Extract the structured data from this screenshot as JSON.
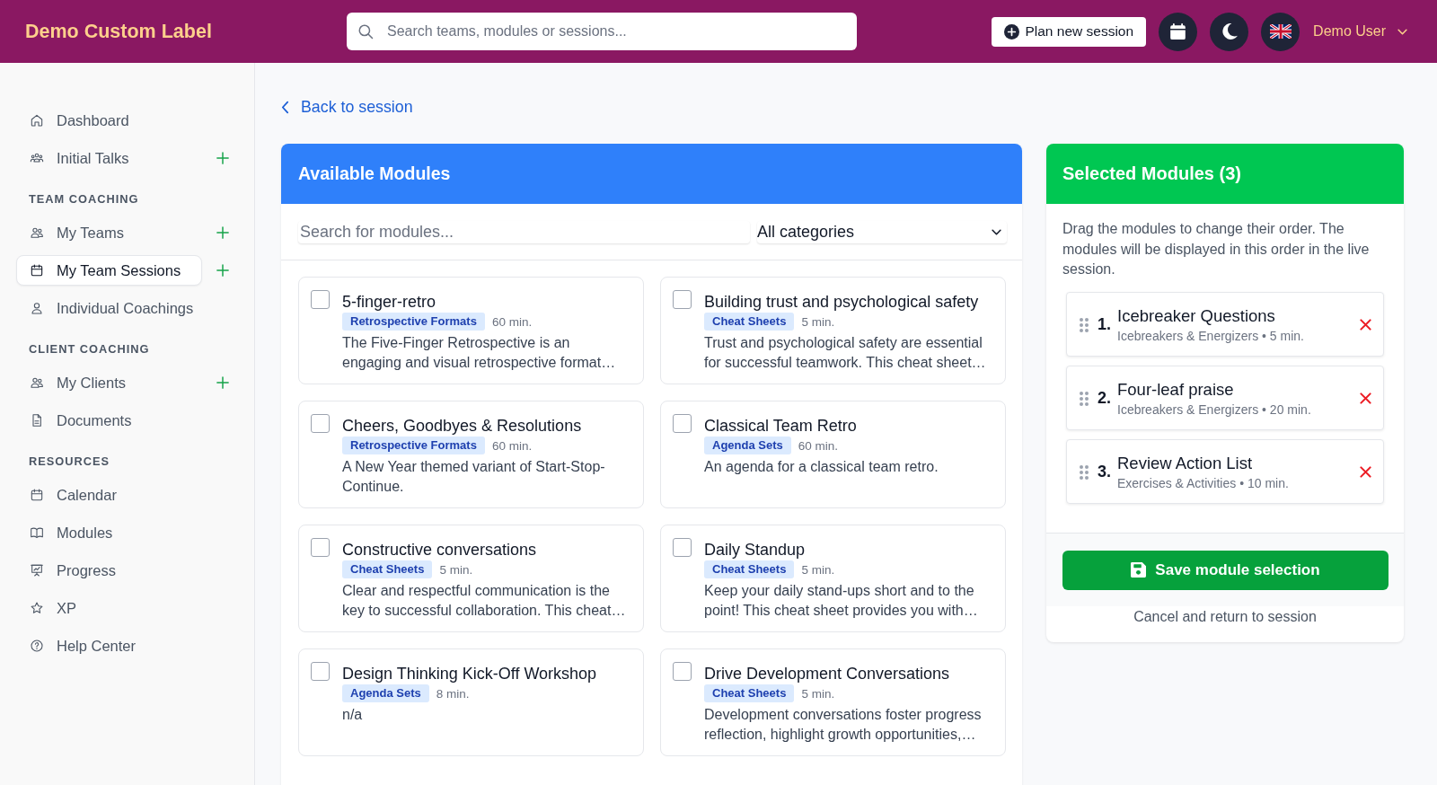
{
  "header": {
    "logo": "Demo Custom Label",
    "search": {
      "placeholder": "Search teams, modules or sessions..."
    },
    "plan_button": "Plan new session",
    "user_menu": "Demo User"
  },
  "sidebar": {
    "groups": [
      {
        "items": [
          {
            "label": "Dashboard",
            "selected": false,
            "add_button": false
          },
          {
            "label": "Initial Talks",
            "selected": false,
            "add_button": true
          }
        ]
      },
      {
        "heading": "TEAM COACHING",
        "items": [
          {
            "label": "My Teams",
            "selected": false,
            "add_button": true
          },
          {
            "label": "My Team Sessions",
            "selected": true,
            "add_button": true
          },
          {
            "label": "Individual Coachings",
            "selected": false,
            "add_button": false
          }
        ]
      },
      {
        "heading": "CLIENT COACHING",
        "items": [
          {
            "label": "My Clients",
            "selected": false,
            "add_button": true
          },
          {
            "label": "Documents",
            "selected": false,
            "add_button": false
          }
        ]
      },
      {
        "heading": "RESOURCES",
        "items": [
          {
            "label": "Calendar",
            "selected": false,
            "add_button": false
          },
          {
            "label": "Modules",
            "selected": false,
            "add_button": false
          },
          {
            "label": "Progress",
            "selected": false,
            "add_button": false
          },
          {
            "label": "XP",
            "selected": false,
            "add_button": false
          },
          {
            "label": "Help Center",
            "selected": false,
            "add_button": false
          }
        ]
      }
    ]
  },
  "back_link": "Back to session",
  "available_modules": {
    "title": "Available Modules",
    "search": {
      "placeholder": "Search for modules..."
    },
    "category_filter": {
      "value": "All categories"
    },
    "modules": [
      {
        "title": "5-finger-retro",
        "category": "Retrospective Formats",
        "duration": "60 min.",
        "description": "The Five-Finger Retrospective is an engaging and visual retrospective format…",
        "checked": false
      },
      {
        "title": "Building trust and psychological safety",
        "category": "Cheat Sheets",
        "duration": "5 min.",
        "description": "Trust and psychological safety are essential for successful teamwork. This cheat sheet…",
        "checked": false
      },
      {
        "title": "Cheers, Goodbyes & Resolutions",
        "category": "Retrospective Formats",
        "duration": "60 min.",
        "description": "A New Year themed variant of Start-Stop-Continue.",
        "checked": false
      },
      {
        "title": "Classical Team Retro",
        "category": "Agenda Sets",
        "duration": "60 min.",
        "description": "An agenda for a classical team retro.",
        "checked": false
      },
      {
        "title": "Constructive conversations",
        "category": "Cheat Sheets",
        "duration": "5 min.",
        "description": "Clear and respectful communication is the key to successful collaboration. This cheat…",
        "checked": false
      },
      {
        "title": "Daily Standup",
        "category": "Cheat Sheets",
        "duration": "5 min.",
        "description": "Keep your daily stand-ups short and to the point! This cheat sheet provides you with…",
        "checked": false
      },
      {
        "title": "Design Thinking Kick-Off Workshop",
        "category": "Agenda Sets",
        "duration": "8 min.",
        "description": "n/a",
        "checked": false
      },
      {
        "title": "Drive Development Conversations",
        "category": "Cheat Sheets",
        "duration": "5 min.",
        "description": "Development conversations foster progress reflection, highlight growth opportunities,…",
        "checked": false
      }
    ]
  },
  "selected_modules": {
    "title": "Selected Modules (3)",
    "hint": "Drag the modules to change their order. The modules will be displayed in this order in the live session.",
    "items": [
      {
        "number": "1.",
        "title": "Icebreaker Questions",
        "meta": "Icebreakers & Energizers • 5 min."
      },
      {
        "number": "2.",
        "title": "Four-leaf praise",
        "meta": "Icebreakers & Energizers • 20 min."
      },
      {
        "number": "3.",
        "title": "Review Action List",
        "meta": "Exercises & Activities • 10 min."
      }
    ],
    "save_button": "Save module selection",
    "cancel_link": "Cancel and return to session"
  }
}
